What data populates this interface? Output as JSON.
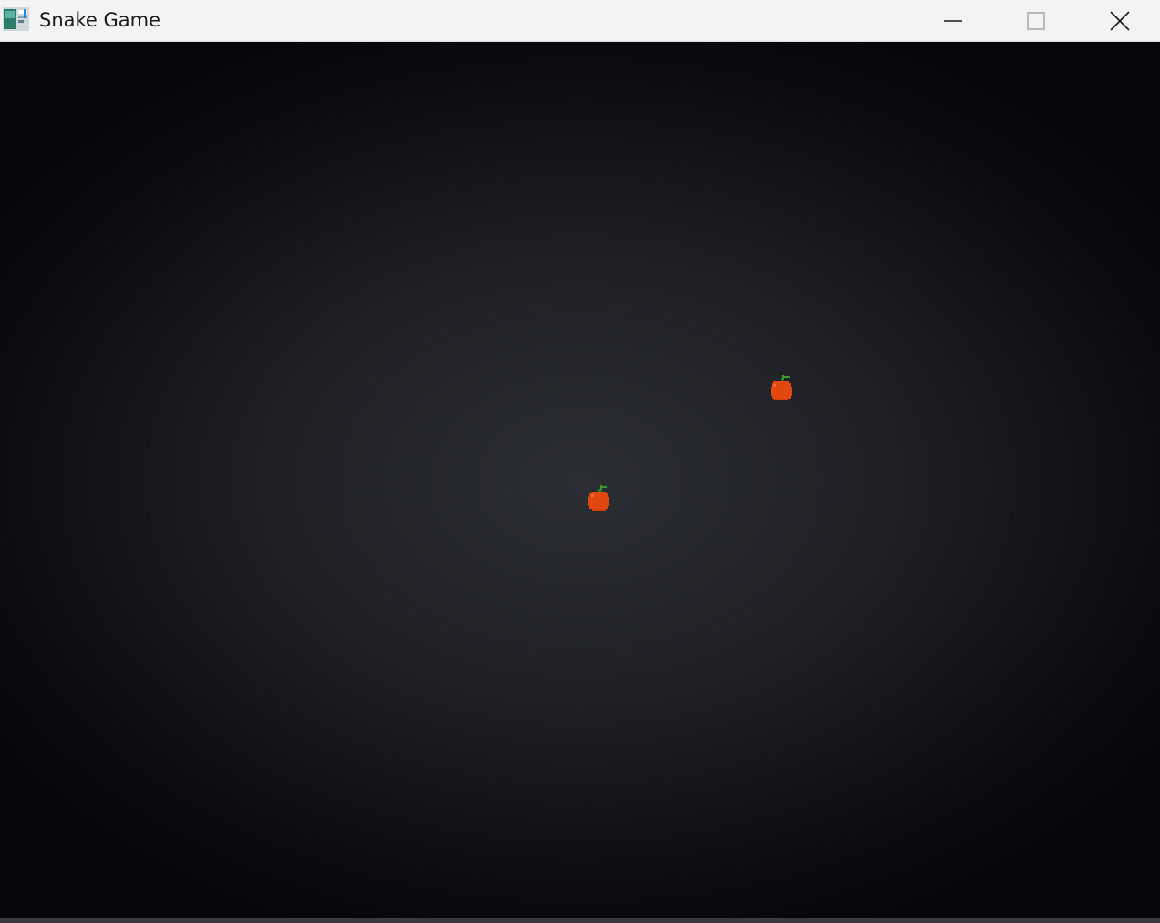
{
  "window": {
    "title": "Snake Game",
    "app_icon": "game-window-icon",
    "controls": {
      "minimize_icon": "minimize-icon",
      "maximize_icon": "maximize-icon",
      "close_icon": "close-icon"
    }
  },
  "game": {
    "background_center_color": "#2c2e35",
    "background_edge_color": "#06070b",
    "food": [
      {
        "icon": "apple-icon",
        "color": "#e0480f",
        "leaf_color": "#3a9c2e"
      },
      {
        "icon": "apple-icon",
        "color": "#e0480f",
        "leaf_color": "#3a9c2e"
      }
    ]
  }
}
